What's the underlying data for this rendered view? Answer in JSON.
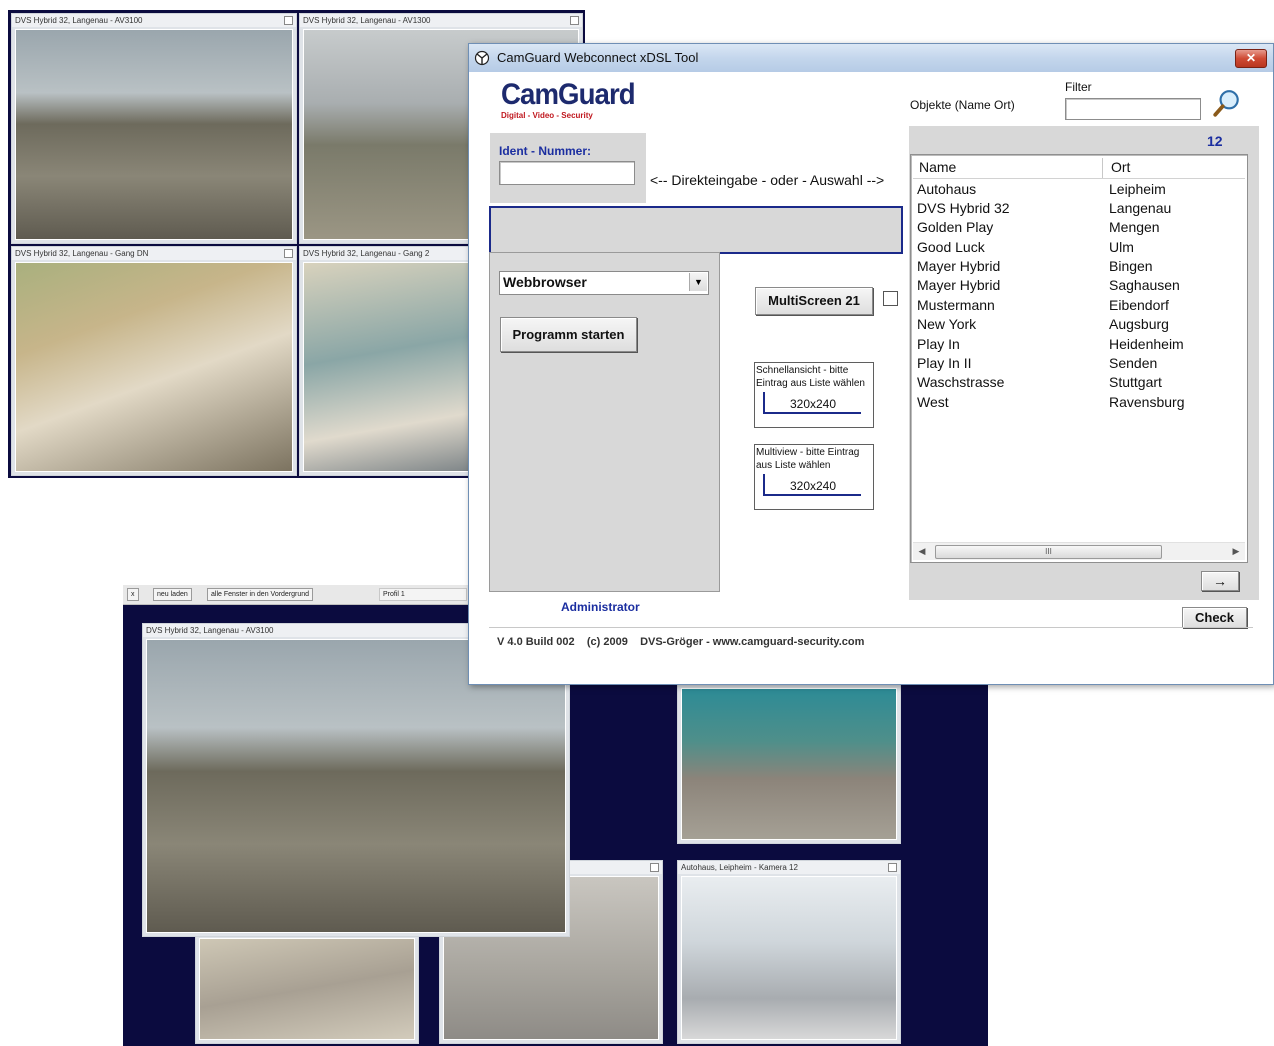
{
  "camera_window_top": {
    "tiles": [
      {
        "caption": "DVS Hybrid 32, Langenau - AV3100"
      },
      {
        "caption": "DVS Hybrid 32, Langenau - AV1300"
      },
      {
        "caption": "DVS Hybrid 32, Langenau - Gang DN"
      },
      {
        "caption": "DVS Hybrid 32, Langenau - Gang 2"
      }
    ]
  },
  "camera_window_bottom": {
    "toolbar": {
      "close": "x",
      "reload": "neu laden",
      "front": "alle Fenster in den Vordergrund",
      "profile": "Profil 1"
    },
    "tiles": [
      {
        "caption": "DVS Hybrid 32, Langenau - AV3100"
      },
      {
        "caption": "Autohaus, Leipheim - Kamera 12"
      }
    ]
  },
  "dialog": {
    "title": "CamGuard Webconnect xDSL Tool",
    "close_label": "✕",
    "logo": {
      "main": "CamGuard",
      "tagline": "Digital - Video - Security"
    },
    "objects_label": "Objekte  (Name Ort)",
    "filter_label": "Filter",
    "filter_value": "",
    "count": "12",
    "ident_label": "Ident - Nummer:",
    "ident_value": "",
    "direct_hint": "<-- Direkteingabe  - oder -  Auswahl -->",
    "program_select": "Webbrowser",
    "start_button": "Programm starten",
    "multiscreen_button": "MultiScreen 21",
    "quick_view": {
      "text": "Schnellansicht - bitte Eintrag aus Liste wählen",
      "size": "320x240"
    },
    "multiview": {
      "text": "Multiview - bitte Eintrag aus Liste wählen",
      "size": "320x240"
    },
    "user_label": "Administrator",
    "arrow_button": "→",
    "check_button": "Check",
    "footer": "V 4.0 Build 002    (c) 2009    DVS-Gröger - www.camguard-security.com",
    "list": {
      "columns": [
        "Name",
        "Ort"
      ],
      "rows": [
        {
          "name": "Autohaus",
          "ort": "Leipheim"
        },
        {
          "name": "DVS Hybrid 32",
          "ort": "Langenau"
        },
        {
          "name": "Golden Play",
          "ort": "Mengen"
        },
        {
          "name": "Good Luck",
          "ort": "Ulm"
        },
        {
          "name": "Mayer Hybrid",
          "ort": "Bingen"
        },
        {
          "name": "Mayer Hybrid",
          "ort": "Saghausen"
        },
        {
          "name": "Mustermann",
          "ort": "Eibendorf"
        },
        {
          "name": "New York",
          "ort": "Augsburg"
        },
        {
          "name": "Play In",
          "ort": "Heidenheim"
        },
        {
          "name": "Play In II",
          "ort": "Senden"
        },
        {
          "name": "Waschstrasse",
          "ort": "Stuttgart"
        },
        {
          "name": "West",
          "ort": "Ravensburg"
        }
      ],
      "scroll_thumb": "III"
    }
  }
}
